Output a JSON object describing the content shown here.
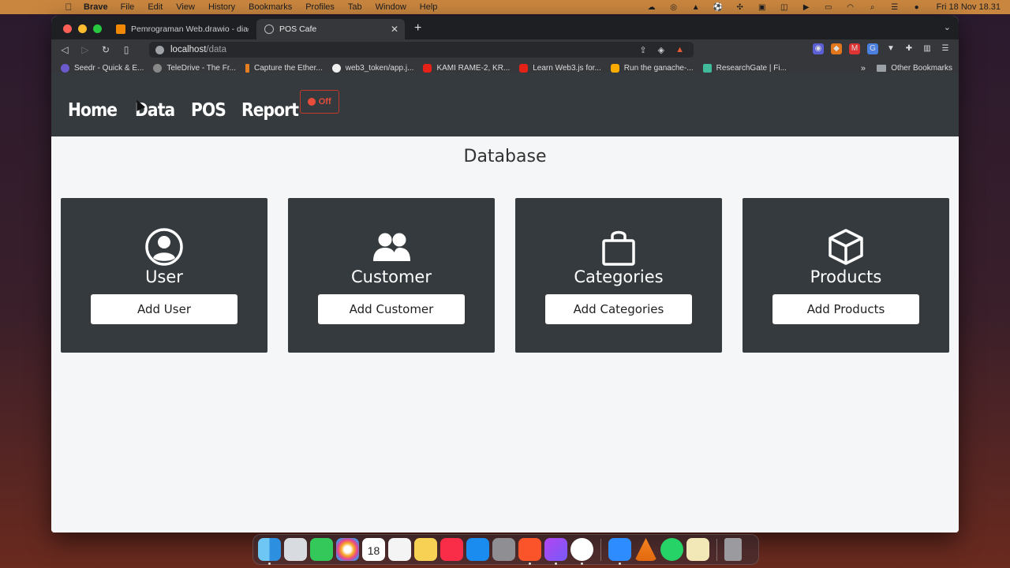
{
  "menubar": {
    "app_name": "Brave",
    "items": [
      "File",
      "Edit",
      "View",
      "History",
      "Bookmarks",
      "Profiles",
      "Tab",
      "Window",
      "Help"
    ],
    "clock": "Fri 18 Nov  18.31"
  },
  "browser": {
    "tabs": [
      {
        "title": "Pemrograman Web.drawio - diagra",
        "active": false
      },
      {
        "title": "POS Cafe",
        "active": true
      }
    ],
    "url_host": "localhost",
    "url_path": "/data",
    "bookmarks": [
      "Seedr - Quick & E...",
      "TeleDrive - The Fr...",
      "Capture the Ether...",
      "web3_token/app.j...",
      "KAMI RAME-2, KR...",
      "Learn Web3.js for...",
      "Run the ganache-...",
      "ResearchGate | Fi..."
    ],
    "more_bookmarks": "»",
    "other_bookmarks": "Other Bookmarks"
  },
  "site": {
    "nav": [
      "Home",
      "Data",
      "POS",
      "Report"
    ],
    "toggle_label": "Off",
    "page_title": "Database",
    "cards": [
      {
        "title": "User",
        "button": "Add User",
        "icon": "user-circle-icon"
      },
      {
        "title": "Customer",
        "button": "Add Customer",
        "icon": "users-icon"
      },
      {
        "title": "Categories",
        "button": "Add Categories",
        "icon": "shopping-bag-icon"
      },
      {
        "title": "Products",
        "button": "Add Products",
        "icon": "box-icon"
      }
    ]
  },
  "calendar_day": "18",
  "colors": {
    "nav_bg": "#343a3d",
    "card_bg": "#343a3d",
    "page_bg": "#f5f6f7",
    "toggle_red": "#e74c3c"
  }
}
